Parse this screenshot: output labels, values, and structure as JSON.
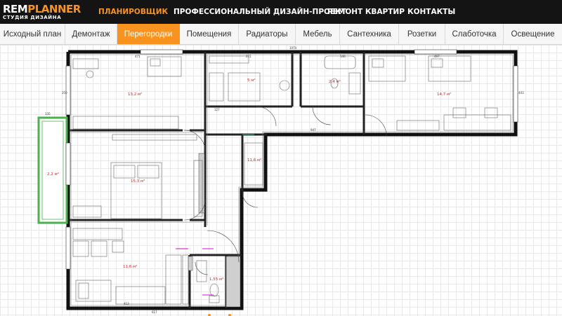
{
  "brand": {
    "name_part1": "REM",
    "name_part2": "PLANNER",
    "tagline": "СТУДИЯ ДИЗАЙНА",
    "accent_color": "#f7931e"
  },
  "top_nav": [
    {
      "label": "ПЛАНИРОВЩИК",
      "active": true
    },
    {
      "label": "ПРОФЕССИОНАЛЬНЫЙ ДИЗАЙН-ПРОЕКТ",
      "active": false
    },
    {
      "label": "РЕМОНТ КВАРТИР",
      "active": false
    },
    {
      "label": "КОНТАКТЫ",
      "active": false
    }
  ],
  "tabs": [
    {
      "label": "Исходный план",
      "active": false
    },
    {
      "label": "Демонтаж",
      "active": false
    },
    {
      "label": "Перегородки",
      "active": true
    },
    {
      "label": "Помещения",
      "active": false
    },
    {
      "label": "Радиаторы",
      "active": false
    },
    {
      "label": "Мебель",
      "active": false
    },
    {
      "label": "Сантехника",
      "active": false
    },
    {
      "label": "Розетки",
      "active": false
    },
    {
      "label": "Слаботочка",
      "active": false
    },
    {
      "label": "Освещение",
      "active": false
    }
  ],
  "plan": {
    "rooms": [
      {
        "id": "room-top-left",
        "area": "13,2 м²"
      },
      {
        "id": "room-wardrobe",
        "area": "5 м²"
      },
      {
        "id": "room-bath",
        "area": "2,4 м²"
      },
      {
        "id": "room-top-right",
        "area": "14,7 м²"
      },
      {
        "id": "room-balcony",
        "area": "2,2 м²"
      },
      {
        "id": "room-bedroom",
        "area": "15,3 м²"
      },
      {
        "id": "room-hall",
        "area": "11,6 м²"
      },
      {
        "id": "room-kitchen",
        "area": "11,6 м²"
      },
      {
        "id": "room-wc",
        "area": "1,55 м²"
      }
    ],
    "dimensions": {
      "top_total": "1070",
      "top_left_width": "471",
      "wardrobe_width": "272",
      "bath_width": "140",
      "right_width": "497",
      "left_side_height": "350",
      "right_side_height": "443",
      "corridor_width": "127",
      "hall_width": "947",
      "bottom_total": "617",
      "kitchen_width": "413",
      "balcony_width": "135"
    }
  }
}
